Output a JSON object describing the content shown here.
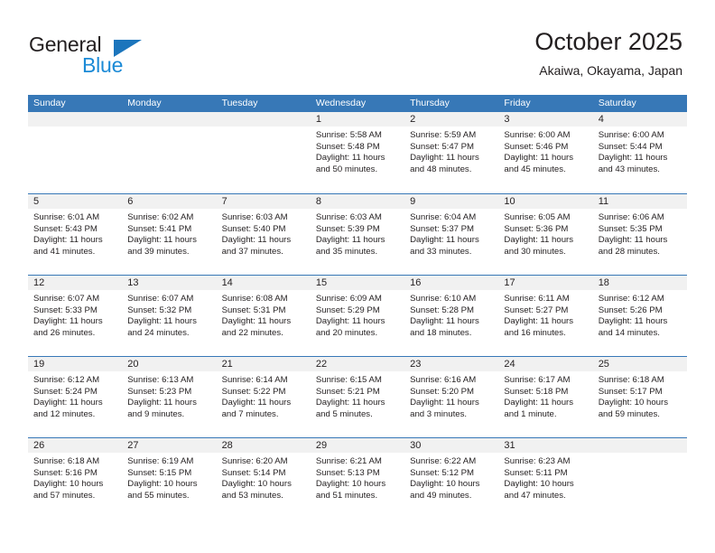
{
  "brand": {
    "name_top": "General",
    "name_bottom": "Blue",
    "triangle_color": "#1b75bc",
    "text_color_top": "#231f20",
    "text_color_bottom": "#1b8ad6"
  },
  "header": {
    "title": "October 2025",
    "subtitle": "Akaiwa, Okayama, Japan"
  },
  "theme": {
    "header_bar_color": "#3778b7",
    "daynum_strip_color": "#f1f1f1",
    "text_color": "#231f20",
    "header_text_color": "#ffffff"
  },
  "weekdays": [
    "Sunday",
    "Monday",
    "Tuesday",
    "Wednesday",
    "Thursday",
    "Friday",
    "Saturday"
  ],
  "weeks": [
    [
      {
        "day": "",
        "empty": true
      },
      {
        "day": "",
        "empty": true
      },
      {
        "day": "",
        "empty": true
      },
      {
        "day": "1",
        "sunrise": "Sunrise: 5:58 AM",
        "sunset": "Sunset: 5:48 PM",
        "daylight_line1": "Daylight: 11 hours",
        "daylight_line2": "and 50 minutes."
      },
      {
        "day": "2",
        "sunrise": "Sunrise: 5:59 AM",
        "sunset": "Sunset: 5:47 PM",
        "daylight_line1": "Daylight: 11 hours",
        "daylight_line2": "and 48 minutes."
      },
      {
        "day": "3",
        "sunrise": "Sunrise: 6:00 AM",
        "sunset": "Sunset: 5:46 PM",
        "daylight_line1": "Daylight: 11 hours",
        "daylight_line2": "and 45 minutes."
      },
      {
        "day": "4",
        "sunrise": "Sunrise: 6:00 AM",
        "sunset": "Sunset: 5:44 PM",
        "daylight_line1": "Daylight: 11 hours",
        "daylight_line2": "and 43 minutes."
      }
    ],
    [
      {
        "day": "5",
        "sunrise": "Sunrise: 6:01 AM",
        "sunset": "Sunset: 5:43 PM",
        "daylight_line1": "Daylight: 11 hours",
        "daylight_line2": "and 41 minutes."
      },
      {
        "day": "6",
        "sunrise": "Sunrise: 6:02 AM",
        "sunset": "Sunset: 5:41 PM",
        "daylight_line1": "Daylight: 11 hours",
        "daylight_line2": "and 39 minutes."
      },
      {
        "day": "7",
        "sunrise": "Sunrise: 6:03 AM",
        "sunset": "Sunset: 5:40 PM",
        "daylight_line1": "Daylight: 11 hours",
        "daylight_line2": "and 37 minutes."
      },
      {
        "day": "8",
        "sunrise": "Sunrise: 6:03 AM",
        "sunset": "Sunset: 5:39 PM",
        "daylight_line1": "Daylight: 11 hours",
        "daylight_line2": "and 35 minutes."
      },
      {
        "day": "9",
        "sunrise": "Sunrise: 6:04 AM",
        "sunset": "Sunset: 5:37 PM",
        "daylight_line1": "Daylight: 11 hours",
        "daylight_line2": "and 33 minutes."
      },
      {
        "day": "10",
        "sunrise": "Sunrise: 6:05 AM",
        "sunset": "Sunset: 5:36 PM",
        "daylight_line1": "Daylight: 11 hours",
        "daylight_line2": "and 30 minutes."
      },
      {
        "day": "11",
        "sunrise": "Sunrise: 6:06 AM",
        "sunset": "Sunset: 5:35 PM",
        "daylight_line1": "Daylight: 11 hours",
        "daylight_line2": "and 28 minutes."
      }
    ],
    [
      {
        "day": "12",
        "sunrise": "Sunrise: 6:07 AM",
        "sunset": "Sunset: 5:33 PM",
        "daylight_line1": "Daylight: 11 hours",
        "daylight_line2": "and 26 minutes."
      },
      {
        "day": "13",
        "sunrise": "Sunrise: 6:07 AM",
        "sunset": "Sunset: 5:32 PM",
        "daylight_line1": "Daylight: 11 hours",
        "daylight_line2": "and 24 minutes."
      },
      {
        "day": "14",
        "sunrise": "Sunrise: 6:08 AM",
        "sunset": "Sunset: 5:31 PM",
        "daylight_line1": "Daylight: 11 hours",
        "daylight_line2": "and 22 minutes."
      },
      {
        "day": "15",
        "sunrise": "Sunrise: 6:09 AM",
        "sunset": "Sunset: 5:29 PM",
        "daylight_line1": "Daylight: 11 hours",
        "daylight_line2": "and 20 minutes."
      },
      {
        "day": "16",
        "sunrise": "Sunrise: 6:10 AM",
        "sunset": "Sunset: 5:28 PM",
        "daylight_line1": "Daylight: 11 hours",
        "daylight_line2": "and 18 minutes."
      },
      {
        "day": "17",
        "sunrise": "Sunrise: 6:11 AM",
        "sunset": "Sunset: 5:27 PM",
        "daylight_line1": "Daylight: 11 hours",
        "daylight_line2": "and 16 minutes."
      },
      {
        "day": "18",
        "sunrise": "Sunrise: 6:12 AM",
        "sunset": "Sunset: 5:26 PM",
        "daylight_line1": "Daylight: 11 hours",
        "daylight_line2": "and 14 minutes."
      }
    ],
    [
      {
        "day": "19",
        "sunrise": "Sunrise: 6:12 AM",
        "sunset": "Sunset: 5:24 PM",
        "daylight_line1": "Daylight: 11 hours",
        "daylight_line2": "and 12 minutes."
      },
      {
        "day": "20",
        "sunrise": "Sunrise: 6:13 AM",
        "sunset": "Sunset: 5:23 PM",
        "daylight_line1": "Daylight: 11 hours",
        "daylight_line2": "and 9 minutes."
      },
      {
        "day": "21",
        "sunrise": "Sunrise: 6:14 AM",
        "sunset": "Sunset: 5:22 PM",
        "daylight_line1": "Daylight: 11 hours",
        "daylight_line2": "and 7 minutes."
      },
      {
        "day": "22",
        "sunrise": "Sunrise: 6:15 AM",
        "sunset": "Sunset: 5:21 PM",
        "daylight_line1": "Daylight: 11 hours",
        "daylight_line2": "and 5 minutes."
      },
      {
        "day": "23",
        "sunrise": "Sunrise: 6:16 AM",
        "sunset": "Sunset: 5:20 PM",
        "daylight_line1": "Daylight: 11 hours",
        "daylight_line2": "and 3 minutes."
      },
      {
        "day": "24",
        "sunrise": "Sunrise: 6:17 AM",
        "sunset": "Sunset: 5:18 PM",
        "daylight_line1": "Daylight: 11 hours",
        "daylight_line2": "and 1 minute."
      },
      {
        "day": "25",
        "sunrise": "Sunrise: 6:18 AM",
        "sunset": "Sunset: 5:17 PM",
        "daylight_line1": "Daylight: 10 hours",
        "daylight_line2": "and 59 minutes."
      }
    ],
    [
      {
        "day": "26",
        "sunrise": "Sunrise: 6:18 AM",
        "sunset": "Sunset: 5:16 PM",
        "daylight_line1": "Daylight: 10 hours",
        "daylight_line2": "and 57 minutes."
      },
      {
        "day": "27",
        "sunrise": "Sunrise: 6:19 AM",
        "sunset": "Sunset: 5:15 PM",
        "daylight_line1": "Daylight: 10 hours",
        "daylight_line2": "and 55 minutes."
      },
      {
        "day": "28",
        "sunrise": "Sunrise: 6:20 AM",
        "sunset": "Sunset: 5:14 PM",
        "daylight_line1": "Daylight: 10 hours",
        "daylight_line2": "and 53 minutes."
      },
      {
        "day": "29",
        "sunrise": "Sunrise: 6:21 AM",
        "sunset": "Sunset: 5:13 PM",
        "daylight_line1": "Daylight: 10 hours",
        "daylight_line2": "and 51 minutes."
      },
      {
        "day": "30",
        "sunrise": "Sunrise: 6:22 AM",
        "sunset": "Sunset: 5:12 PM",
        "daylight_line1": "Daylight: 10 hours",
        "daylight_line2": "and 49 minutes."
      },
      {
        "day": "31",
        "sunrise": "Sunrise: 6:23 AM",
        "sunset": "Sunset: 5:11 PM",
        "daylight_line1": "Daylight: 10 hours",
        "daylight_line2": "and 47 minutes."
      },
      {
        "day": "",
        "empty": true
      }
    ]
  ]
}
